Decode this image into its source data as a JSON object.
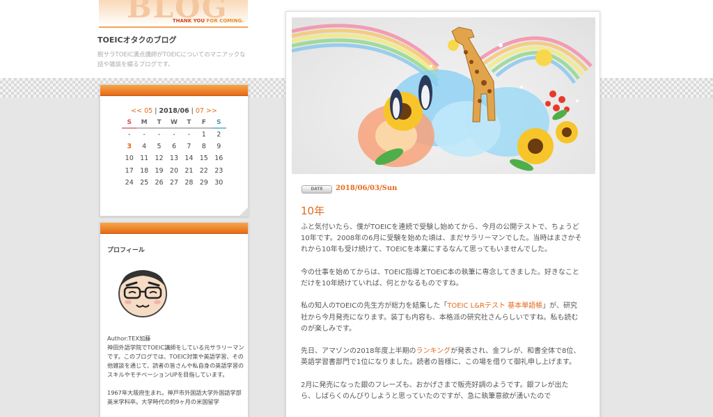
{
  "header": {
    "logo_text": "BLOG",
    "logo_tag_a": "THANK YOU ",
    "logo_tag_b": "FOR COMING.",
    "blog_title": "TOEICオタクのブログ",
    "blog_desc": "脱サラTOEIC満点講師がTOEICについてのマニアックな話や雑談を綴るブログです。"
  },
  "calendar": {
    "prev": "<< 05",
    "sep1": " | ",
    "current": "2018/06",
    "sep2": " | ",
    "next": "07 >>",
    "weekdays": [
      "S",
      "M",
      "T",
      "W",
      "T",
      "F",
      "S"
    ],
    "weeks": [
      [
        "-",
        "-",
        "-",
        "-",
        "-",
        "1",
        "2"
      ],
      [
        "3",
        "4",
        "5",
        "6",
        "7",
        "8",
        "9"
      ],
      [
        "10",
        "11",
        "12",
        "13",
        "14",
        "15",
        "16"
      ],
      [
        "17",
        "18",
        "19",
        "20",
        "21",
        "22",
        "23"
      ],
      [
        "24",
        "25",
        "26",
        "27",
        "28",
        "29",
        "30"
      ]
    ]
  },
  "profile": {
    "title": "プロフィール",
    "author": "Author:TEX加藤",
    "bio1": "神田外語学院でTOEIC講師をしている元サラリーマンです。このブログでは、TOEIC対策や英語学習、その他雑談を通じて、読者の皆さんや私自身の英語学習のスキルやモチベーションUPを目指しています。",
    "bio2": "1967年大阪府生まれ。神戸市外国語大学外国語学部英米学科卒。大学時代の約9ヶ月の米国留学"
  },
  "post": {
    "date_badge": "DATE",
    "date": "2018/06/03/Sun",
    "title": "10年",
    "p1": "ふと気付いたら、僕がTOEICを連続で受験し始めてから、今月の公開テストで、ちょうど10年です。2008年の6月に受験を始めた頃は、まだサラリーマンでした。当時はまさかそれから10年も受け続けて、TOEICを本業にするなんて思ってもいませんでした。",
    "p2": "今の仕事を始めてからは、TOEIC指導とTOEIC本の執筆に専念してきました。好きなことだけを10年続けていれば、何とかなるものですね。",
    "p3_a": "私の知人のTOEICの先生方が総力を結集した「",
    "p3_link": "TOEIC L&Rテスト 基本単語帳",
    "p3_b": "」が、研究社から今月発売になります。装丁も内容も、本格派の研究社さんらしいですね。私も読むのが楽しみです。",
    "p4_a": "先日、アマゾンの2018年度上半期の",
    "p4_link": "ランキング",
    "p4_b": "が発表され、金フレが、和書全体で8位、英語学習書部門で1位になりました。読者の皆様に、この場を借りて御礼申し上げます。",
    "p5": "2月に発売になった銀のフレーズも、おかげさまで販売好調のようです。銀フレが出たら、しばらくのんびりしようと思っていたのですが、急に執筆意欲が湧いたので"
  },
  "colors": {
    "accent": "#e46a1c",
    "sunday": "#d05050",
    "saturday": "#4a98b8"
  }
}
